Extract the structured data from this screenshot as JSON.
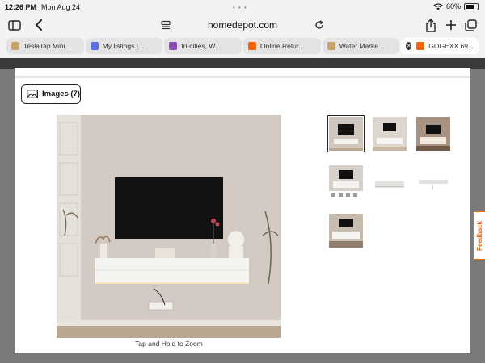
{
  "status": {
    "time": "12:26 PM",
    "date": "Mon Aug 24",
    "battery": "60%",
    "battery_level": 0.6
  },
  "browser": {
    "url": "homedepot.com"
  },
  "tabs": [
    {
      "label": "TeslaTap Mini...",
      "favicon_color": "#c9a36a"
    },
    {
      "label": "My listings |...",
      "favicon_color": "#5a6ee0"
    },
    {
      "label": "tri-cities, W...",
      "favicon_color": "#8a4bb5"
    },
    {
      "label": "Online Retur...",
      "favicon_color": "#f96302"
    },
    {
      "label": "Water Marke...",
      "favicon_color": "#c9a36a"
    },
    {
      "label": "GOGEXX 69...",
      "favicon_color": "#f96302",
      "active": true
    }
  ],
  "modal": {
    "badge_label": "Images (7)",
    "zoom_hint": "Tap and Hold to Zoom",
    "thumbnails": [
      "thumbnail-1",
      "thumbnail-2",
      "thumbnail-3",
      "thumbnail-4",
      "thumbnail-5",
      "thumbnail-6",
      "thumbnail-7"
    ]
  },
  "feedback_label": "Feedback",
  "colors": {
    "accent": "#f96302"
  }
}
